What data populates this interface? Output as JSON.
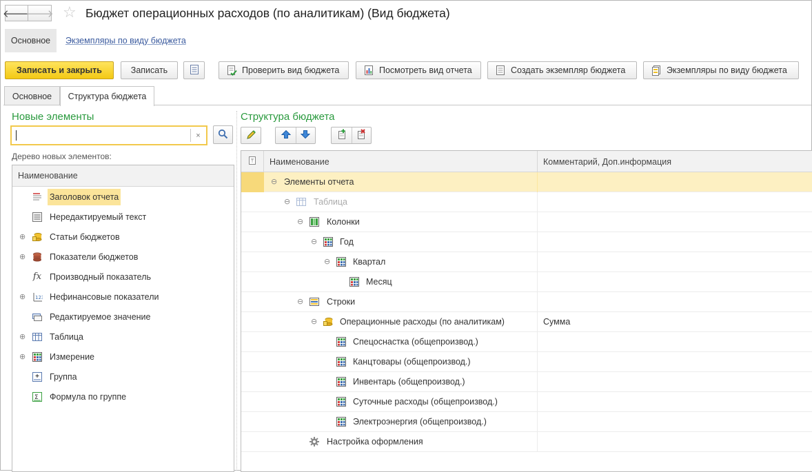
{
  "window": {
    "title": "Бюджет операционных расходов (по аналитикам) (Вид бюджета)"
  },
  "nav": {
    "back_glyph": "🡐",
    "forward_glyph": "🡒",
    "star_glyph": "☆"
  },
  "form_nav": {
    "active": "Основное",
    "link": "Экземпляры по виду бюджета"
  },
  "toolbar": {
    "save_close": "Записать и закрыть",
    "save": "Записать",
    "check": "Проверить вид бюджета",
    "view_report": "Посмотреть вид отчета",
    "create_instance": "Создать экземпляр бюджета",
    "instances": "Экземпляры по виду бюджета"
  },
  "tabs": [
    {
      "label": "Основное"
    },
    {
      "label": "Структура бюджета"
    }
  ],
  "left": {
    "heading": "Новые элементы",
    "search_value": "",
    "clear_glyph": "×",
    "tree_label": "Дерево новых элементов:",
    "column": "Наименование",
    "items": [
      {
        "label": "Заголовок отчета",
        "icon": "report-header-icon",
        "expand": ""
      },
      {
        "label": "Нередактируемый текст",
        "icon": "readonly-text-icon",
        "expand": ""
      },
      {
        "label": "Статьи бюджетов",
        "icon": "budget-items-icon",
        "expand": "⊕"
      },
      {
        "label": "Показатели бюджетов",
        "icon": "budget-indicators-icon",
        "expand": "⊕"
      },
      {
        "label": "Производный показатель",
        "icon": "formula-fx-icon",
        "expand": ""
      },
      {
        "label": "Нефинансовые показатели",
        "icon": "nonfinancial-icon",
        "expand": "⊕"
      },
      {
        "label": "Редактируемое значение",
        "icon": "editable-value-icon",
        "expand": ""
      },
      {
        "label": "Таблица",
        "icon": "table-icon",
        "expand": "⊕"
      },
      {
        "label": "Измерение",
        "icon": "dimension-icon",
        "expand": "⊕"
      },
      {
        "label": "Группа",
        "icon": "group-icon",
        "expand": ""
      },
      {
        "label": "Формула по группе",
        "icon": "group-formula-icon",
        "expand": ""
      }
    ]
  },
  "right": {
    "heading": "Структура бюджета",
    "col_name": "Наименование",
    "col_comment": "Комментарий, Доп.информация",
    "rows": [
      {
        "label": "Элементы отчета",
        "comment": "",
        "expand": "⊖",
        "icon": "",
        "dim": false
      },
      {
        "label": "Таблица",
        "comment": "",
        "expand": "⊖",
        "icon": "table-icon",
        "dim": true
      },
      {
        "label": "Колонки",
        "comment": "",
        "expand": "⊖",
        "icon": "columns-icon",
        "dim": false
      },
      {
        "label": "Год",
        "comment": "",
        "expand": "⊖",
        "icon": "dimension-icon",
        "dim": false
      },
      {
        "label": "Квартал",
        "comment": "",
        "expand": "⊖",
        "icon": "dimension-icon",
        "dim": false
      },
      {
        "label": "Месяц",
        "comment": "",
        "expand": "",
        "icon": "dimension-icon",
        "dim": false
      },
      {
        "label": "Строки",
        "comment": "",
        "expand": "⊖",
        "icon": "rows-icon",
        "dim": false
      },
      {
        "label": "Операционные расходы (по аналитикам)",
        "comment": "Сумма",
        "expand": "⊖",
        "icon": "budget-items-icon",
        "dim": false
      },
      {
        "label": "Спецоснастка (общепроизвод.)",
        "comment": "",
        "expand": "",
        "icon": "dimension-icon",
        "dim": false
      },
      {
        "label": "Канцтовары (общепроизвод.)",
        "comment": "",
        "expand": "",
        "icon": "dimension-icon",
        "dim": false
      },
      {
        "label": "Инвентарь (общепроизвод.)",
        "comment": "",
        "expand": "",
        "icon": "dimension-icon",
        "dim": false
      },
      {
        "label": "Суточные расходы (общепроизвод.)",
        "comment": "",
        "expand": "",
        "icon": "dimension-icon",
        "dim": false
      },
      {
        "label": "Электроэнергия (общепроизвод.)",
        "comment": "",
        "expand": "",
        "icon": "dimension-icon",
        "dim": false
      },
      {
        "label": "Настройка оформления",
        "comment": "",
        "expand": "",
        "icon": "gear-icon",
        "dim": false
      }
    ]
  },
  "colors": {
    "accent_green": "#2a9a3e",
    "primary_button": "#f3c914",
    "selection": "#fbe49a",
    "link": "#3a5a9e"
  }
}
